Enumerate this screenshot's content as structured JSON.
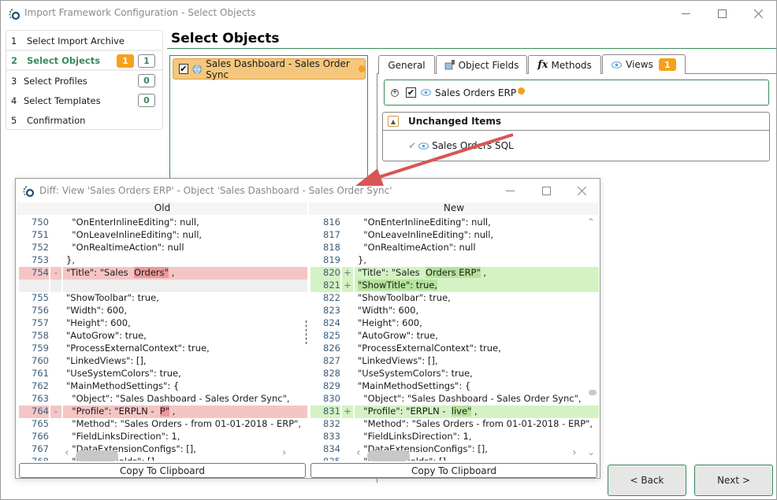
{
  "window": {
    "title": "Import Framework Configuration - Select Objects",
    "controls": {
      "minimize": "minimize",
      "maximize": "maximize",
      "close": "close"
    }
  },
  "steps": [
    {
      "num": "1",
      "label": "Select Import Archive"
    },
    {
      "num": "2",
      "label": "Select Objects",
      "badges": [
        "1",
        "1"
      ]
    },
    {
      "num": "3",
      "label": "Select Profiles",
      "badges": [
        "0"
      ]
    },
    {
      "num": "4",
      "label": "Select Templates",
      "badges": [
        "0"
      ]
    },
    {
      "num": "5",
      "label": "Confirmation"
    }
  ],
  "heading": "Select Objects",
  "objects": [
    {
      "label": "Sales Dashboard - Sales Order Sync",
      "checked": true,
      "changed": true
    }
  ],
  "tabs": [
    {
      "label": "General"
    },
    {
      "label": "Object Fields",
      "icon": "object-fields-icon"
    },
    {
      "label": "Methods",
      "icon": "fx-icon",
      "icon_text": "fx"
    },
    {
      "label": "Views",
      "icon": "eye-icon",
      "badge": "1",
      "active": true
    }
  ],
  "views": {
    "changed": [
      {
        "label": "Sales Orders ERP",
        "checked": true,
        "changed": true
      }
    ],
    "unchanged_header": "Unchanged Items",
    "unchanged": [
      {
        "label": "Sales Orders SQL"
      }
    ]
  },
  "nav": {
    "back": "< Back",
    "next": "Next >"
  },
  "colors": {
    "accent": "#3a8a5a",
    "orange": "#f5a11c",
    "deleted": "#f5c5c5",
    "added": "#d4f2c4"
  },
  "diff": {
    "title": "Diff: View 'Sales Orders ERP' - Object 'Sales Dashboard - Sales Order Sync'",
    "old_header": "Old",
    "new_header": "New",
    "copy_label": "Copy To Clipboard",
    "old_lines": [
      {
        "n": "750",
        "t": "  \"OnEnterInlineEditing\": null,"
      },
      {
        "n": "751",
        "t": "  \"OnLeaveInlineEditing\": null,"
      },
      {
        "n": "752",
        "t": "  \"OnRealtimeAction\": null"
      },
      {
        "n": "753",
        "t": "},"
      },
      {
        "n": "754",
        "m": "-",
        "type": "del",
        "pre": "\"Title\": \"Sales  ",
        "hl": "Orders\"",
        "post": " ,"
      },
      {
        "n": "",
        "type": "empty",
        "t": ""
      },
      {
        "n": "755",
        "t": "\"ShowToolbar\": true,"
      },
      {
        "n": "756",
        "t": "\"Width\": 600,"
      },
      {
        "n": "757",
        "t": "\"Height\": 600,"
      },
      {
        "n": "758",
        "t": "\"AutoGrow\": true,"
      },
      {
        "n": "759",
        "t": "\"ProcessExternalContext\": true,"
      },
      {
        "n": "760",
        "t": "\"LinkedViews\": [],"
      },
      {
        "n": "761",
        "t": "\"UseSystemColors\": true,"
      },
      {
        "n": "762",
        "t": "\"MainMethodSettings\": {"
      },
      {
        "n": "763",
        "t": "  \"Object\": \"Sales Dashboard - Sales Order Sync\","
      },
      {
        "n": "764",
        "m": "-",
        "type": "del",
        "pre": "  \"Profile\": \"ERPLN -  ",
        "hl": "P\"",
        "post": " ,"
      },
      {
        "n": "765",
        "t": "  \"Method\": \"Sales Orders - from 01-01-2018 - ERP\","
      },
      {
        "n": "766",
        "t": "  \"FieldLinksDirection\": 1,"
      },
      {
        "n": "767",
        "t": "  \"DataExtensionConfigs\": [],"
      },
      {
        "n": "768",
        "t": "  \"ContextFields\": []"
      }
    ],
    "new_lines": [
      {
        "n": "816",
        "t": "  \"OnEnterInlineEditing\": null,"
      },
      {
        "n": "817",
        "t": "  \"OnLeaveInlineEditing\": null,"
      },
      {
        "n": "818",
        "t": "  \"OnRealtimeAction\": null"
      },
      {
        "n": "819",
        "t": "},"
      },
      {
        "n": "820",
        "m": "+",
        "type": "add",
        "pre": "\"Title\": \"Sales  ",
        "hl": "Orders ERP\"",
        "post": " ,"
      },
      {
        "n": "821",
        "m": "+",
        "type": "add",
        "pre": "",
        "hl": "\"ShowTitle\": true,",
        "post": ""
      },
      {
        "n": "822",
        "t": "\"ShowToolbar\": true,"
      },
      {
        "n": "823",
        "t": "\"Width\": 600,"
      },
      {
        "n": "824",
        "t": "\"Height\": 600,"
      },
      {
        "n": "825",
        "t": "\"AutoGrow\": true,"
      },
      {
        "n": "826",
        "t": "\"ProcessExternalContext\": true,"
      },
      {
        "n": "827",
        "t": "\"LinkedViews\": [],"
      },
      {
        "n": "828",
        "t": "\"UseSystemColors\": true,"
      },
      {
        "n": "829",
        "t": "\"MainMethodSettings\": {"
      },
      {
        "n": "830",
        "t": "  \"Object\": \"Sales Dashboard - Sales Order Sync\","
      },
      {
        "n": "831",
        "m": "+",
        "type": "add",
        "pre": "  \"Profile\": \"ERPLN -  ",
        "hl": "live\"",
        "post": " ,"
      },
      {
        "n": "832",
        "t": "  \"Method\": \"Sales Orders - from 01-01-2018 - ERP\","
      },
      {
        "n": "833",
        "t": "  \"FieldLinksDirection\": 1,"
      },
      {
        "n": "834",
        "t": "  \"DataExtensionConfigs\": [],"
      },
      {
        "n": "835",
        "t": "  \"ContextFields\": []"
      }
    ]
  }
}
